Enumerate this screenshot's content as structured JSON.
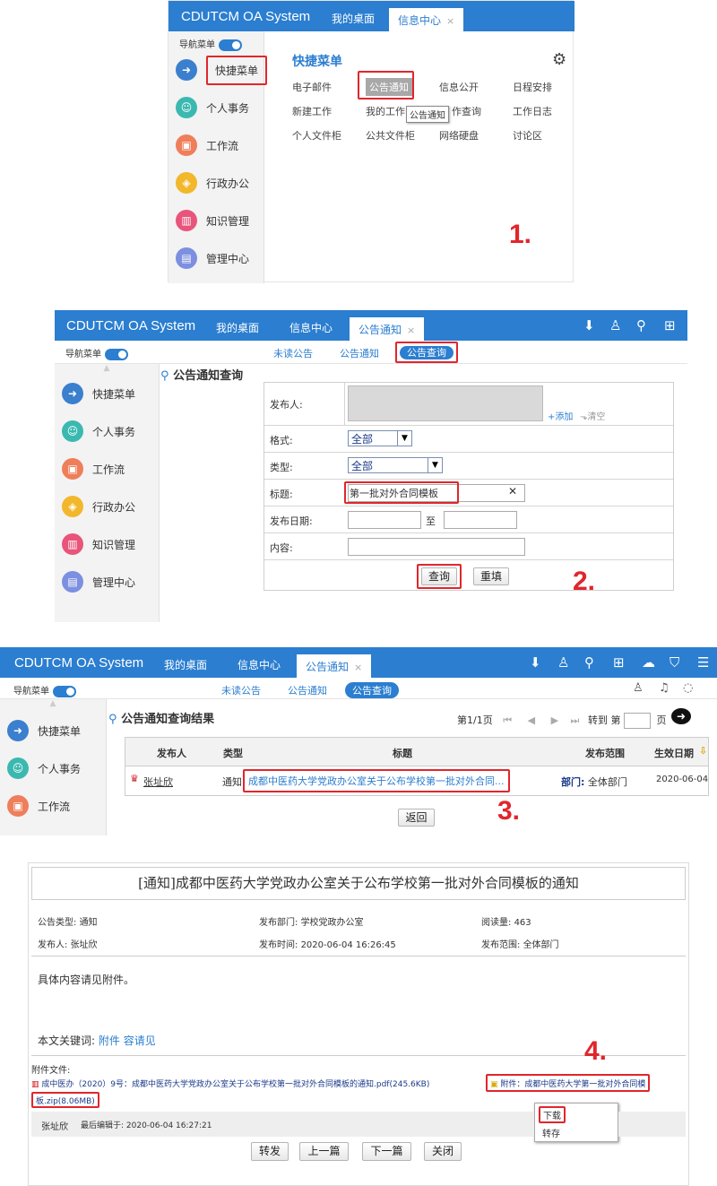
{
  "app": {
    "title": "CDUTCM OA System"
  },
  "panel1": {
    "tabs": [
      "我的桌面",
      "信息中心"
    ],
    "close": "×",
    "nav_label": "导航菜单",
    "sidebar": [
      "快捷菜单",
      "个人事务",
      "工作流",
      "行政办公",
      "知识管理",
      "管理中心"
    ],
    "section_title": "快捷菜单",
    "quick_items": [
      "电子邮件",
      "公告通知",
      "信息公开",
      "日程安排",
      "新建工作",
      "我的工作",
      "作查询",
      "工作日志",
      "个人文件柜",
      "公共文件柜",
      "网络硬盘",
      "讨论区"
    ],
    "tooltip": "公告通知",
    "step": "1."
  },
  "panel2": {
    "tabs": [
      "我的桌面",
      "信息中心",
      "公告通知"
    ],
    "close": "×",
    "nav_label": "导航菜单",
    "subtabs": [
      "未读公告",
      "公告通知",
      "公告查询"
    ],
    "sidebar": [
      "快捷菜单",
      "个人事务",
      "工作流",
      "行政办公",
      "知识管理",
      "管理中心"
    ],
    "title": "公告通知查询",
    "labels": {
      "publisher": "发布人:",
      "format": "格式:",
      "type": "类型:",
      "title": "标题:",
      "date": "发布日期:",
      "content": "内容:"
    },
    "add": "+添加",
    "clear": "清空",
    "format_value": "全部",
    "type_value": "全部",
    "title_value": "第一批对外合同模板",
    "clear_x": "✕",
    "to": "至",
    "query_btn": "查询",
    "reset_btn": "重填",
    "step": "2."
  },
  "panel3": {
    "tabs": [
      "我的桌面",
      "信息中心",
      "公告通知"
    ],
    "close": "×",
    "nav_label": "导航菜单",
    "subtabs": [
      "未读公告",
      "公告通知",
      "公告查询"
    ],
    "sidebar": [
      "快捷菜单",
      "个人事务",
      "工作流"
    ],
    "title": "公告通知查询结果",
    "page_info": "第1/1页",
    "goto": "转到 第",
    "page_unit": "页",
    "columns": [
      "发布人",
      "类型",
      "标题",
      "发布范围",
      "生效日期"
    ],
    "row": {
      "publisher": "张址欣",
      "type": "通知",
      "title": "成都中医药大学党政办公室关于公布学校第一批对外合同...",
      "scope_label": "部门:",
      "scope": "全体部门",
      "date": "2020-06-04"
    },
    "back_btn": "返回",
    "step": "3."
  },
  "panel4": {
    "doc_title": "[通知]成都中医药大学党政办公室关于公布学校第一批对外合同模板的通知",
    "meta": {
      "type_label": "公告类型:",
      "type": "通知",
      "dept_label": "发布部门:",
      "dept": "学校党政办公室",
      "reads_label": "阅读量:",
      "reads": "463",
      "publisher_label": "发布人:",
      "publisher": "张址欣",
      "time_label": "发布时间:",
      "time": "2020-06-04 16:26:45",
      "scope_label": "发布范围:",
      "scope": "全体部门"
    },
    "body": "具体内容请见附件。",
    "keywords_label": "本文关键词:",
    "keywords": "附件 容请见",
    "attach_label": "附件文件:",
    "attach1": "成中医办（2020）9号：成都中医药大学党政办公室关于公布学校第一批对外合同模板的通知.pdf(245.6KB)",
    "attach2_a": "附件：成都中医药大学第一批对外合同模",
    "attach2_b": "板.zip(8.06MB)",
    "menu": [
      "下载",
      "转存"
    ],
    "footer_author": "张址欣",
    "footer_edit": "最后编辑于: 2020-06-04 16:27:21",
    "buttons": [
      "转发",
      "上一篇",
      "下一篇",
      "关闭"
    ],
    "step": "4."
  },
  "colors": {
    "brand": "#2b7ed0",
    "highlight": "#e0262c"
  }
}
